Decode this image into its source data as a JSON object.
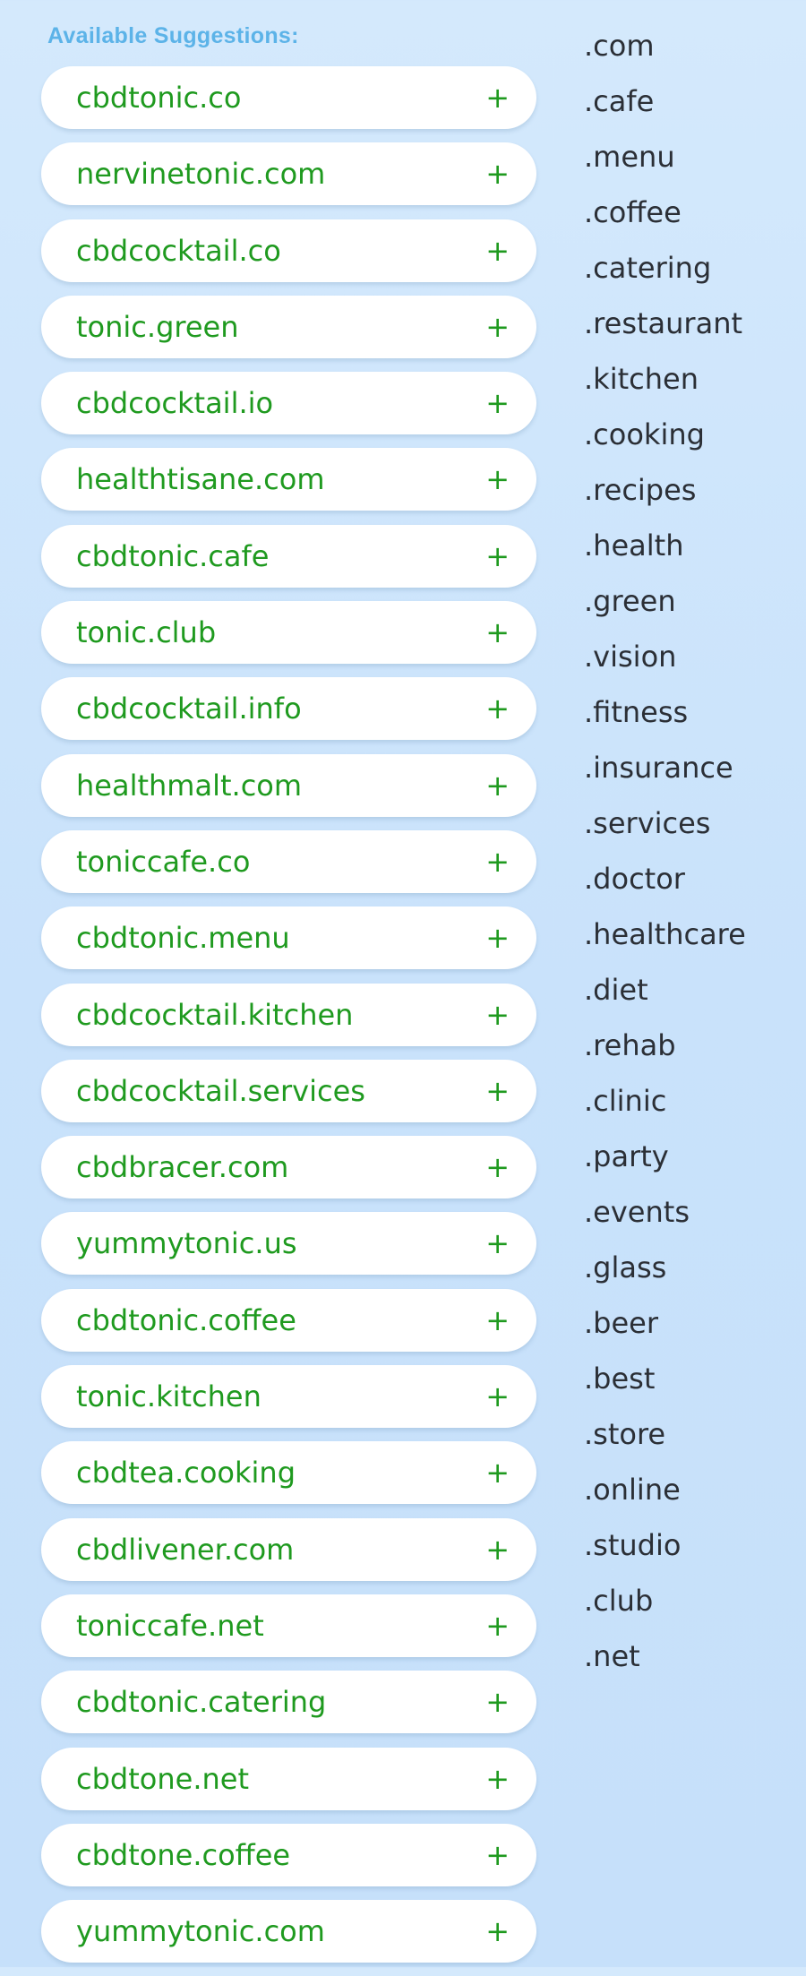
{
  "title": "Available Suggestions:",
  "suggestions": [
    {
      "name": "cbdtonic.co"
    },
    {
      "name": "nervinetonic.com"
    },
    {
      "name": "cbdcocktail.co"
    },
    {
      "name": "tonic.green"
    },
    {
      "name": "cbdcocktail.io"
    },
    {
      "name": "healthtisane.com"
    },
    {
      "name": "cbdtonic.cafe"
    },
    {
      "name": "tonic.club"
    },
    {
      "name": "cbdcocktail.info"
    },
    {
      "name": "healthmalt.com"
    },
    {
      "name": "toniccafe.co"
    },
    {
      "name": "cbdtonic.menu"
    },
    {
      "name": "cbdcocktail.kitchen"
    },
    {
      "name": "cbdcocktail.services"
    },
    {
      "name": "cbdbracer.com"
    },
    {
      "name": "yummytonic.us"
    },
    {
      "name": "cbdtonic.coffee"
    },
    {
      "name": "tonic.kitchen"
    },
    {
      "name": "cbdtea.cooking"
    },
    {
      "name": "cbdlivener.com"
    },
    {
      "name": "toniccafe.net"
    },
    {
      "name": "cbdtonic.catering"
    },
    {
      "name": "cbdtone.net"
    },
    {
      "name": "cbdtone.coffee"
    },
    {
      "name": "yummytonic.com"
    }
  ],
  "add_symbol": "+",
  "add_icon": "plus-icon",
  "tlds": [
    ".com",
    ".cafe",
    ".menu",
    ".coffee",
    ".catering",
    ".restaurant",
    ".kitchen",
    ".cooking",
    ".recipes",
    ".health",
    ".green",
    ".vision",
    ".fitness",
    ".insurance",
    ".services",
    ".doctor",
    ".healthcare",
    ".diet",
    ".rehab",
    ".clinic",
    ".party",
    ".events",
    ".glass",
    ".beer",
    ".best",
    ".store",
    ".online",
    ".studio",
    ".club",
    ".net"
  ],
  "colors": {
    "title": "#5cb3e8",
    "suggestion_text": "#1f9a1f",
    "tld_text": "#2b2f36",
    "card_background": "#ffffff",
    "page_background": "#cbe3fb"
  }
}
